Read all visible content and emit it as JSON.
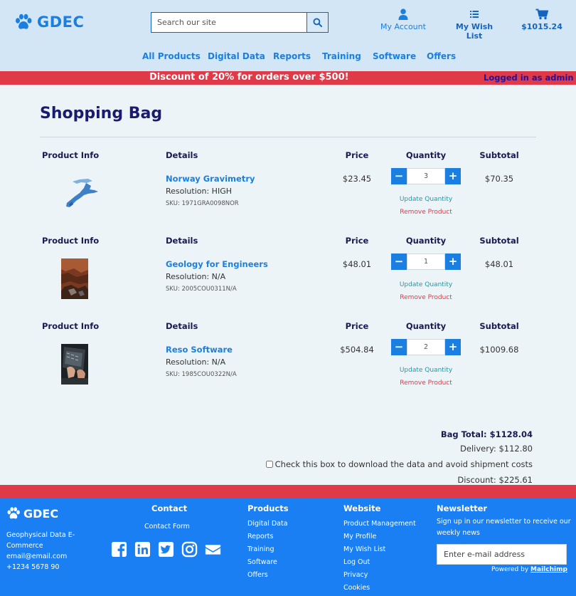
{
  "brand": {
    "name": "GDEC"
  },
  "search": {
    "placeholder": "Search our site"
  },
  "header": {
    "my_account": "My Account",
    "wish_list": "My Wish List",
    "cart_total": "$1015.24"
  },
  "nav": [
    "All Products",
    "Digital Data",
    "Reports",
    "Training",
    "Software",
    "Offers"
  ],
  "banner": {
    "text": "Discount of 20% for orders over $500!",
    "login": "Logged in as admin"
  },
  "page": {
    "title": "Shopping Bag"
  },
  "columns": {
    "info": "Product Info",
    "details": "Details",
    "price": "Price",
    "quantity": "Quantity",
    "subtotal": "Subtotal"
  },
  "items": [
    {
      "name": "Norway Gravimetry",
      "resolution": "Resolution: HIGH",
      "sku": "SKU: 1971GRA0098NOR",
      "price": "$23.45",
      "quantity": "3",
      "subtotal": "$70.35",
      "image": "norway-map-image"
    },
    {
      "name": "Geology for Engineers",
      "resolution": "Resolution: N/A",
      "sku": "SKU: 2005COU0311N/A",
      "price": "$48.01",
      "quantity": "1",
      "subtotal": "$48.01",
      "image": "rock-formation-image"
    },
    {
      "name": "Reso Software",
      "resolution": "Resolution: N/A",
      "sku": "SKU: 1985COU0322N/A",
      "price": "$504.84",
      "quantity": "2",
      "subtotal": "$1009.68",
      "image": "laptop-typing-image"
    }
  ],
  "actions": {
    "update": "Update Quantity",
    "remove": "Remove Product",
    "minus": "−",
    "plus": "+"
  },
  "totals": {
    "bag_total": "Bag Total: $1128.04",
    "delivery": "Delivery: $112.80",
    "download_check": "Check this box to download the data and avoid shipment costs",
    "download_checked": false,
    "discount": "Discount: $225.61"
  },
  "footer": {
    "brand": "GDEC",
    "description": "Geophysical Data E-Commerce",
    "email": "email@email.com",
    "phone": "+1234 5678 90",
    "contact_head": "Contact",
    "contact_form": "Contact Form",
    "social_icons": [
      "facebook-icon",
      "linkedin-icon",
      "twitter-icon",
      "instagram-icon",
      "envelope-icon"
    ],
    "products_head": "Products",
    "products": [
      "Digital Data",
      "Reports",
      "Training",
      "Software",
      "Offers"
    ],
    "website_head": "Website",
    "website": [
      "Product Management",
      "My Profile",
      "My Wish List",
      "Log Out",
      "Privacy",
      "Cookies"
    ],
    "newsletter_head": "Newsletter",
    "newsletter_text": "Sign up in our newsletter to receive our weekly news",
    "newsletter_placeholder": "Enter e-mail address",
    "powered_by": "Powered by",
    "powered_link": "Mailchimp"
  },
  "colors": {
    "header_bg": "#d3e6f6",
    "accent": "#1a7fe0",
    "banner_red": "#e03a48",
    "footer_bg": "#1a7ff2",
    "page_bg": "#ecf4f8"
  }
}
